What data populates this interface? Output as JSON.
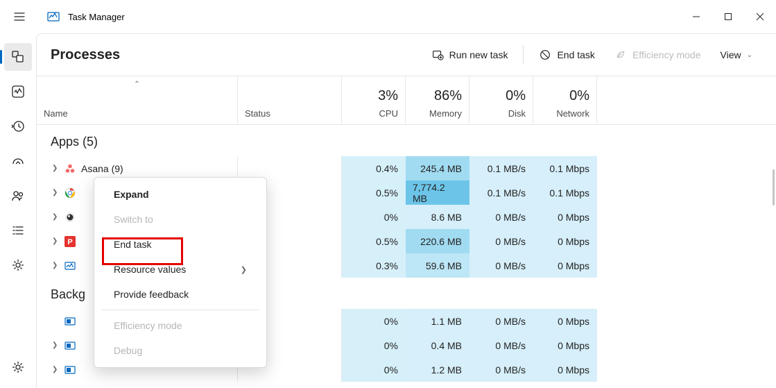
{
  "app": {
    "title": "Task Manager"
  },
  "toolbar": {
    "page_title": "Processes",
    "run_new_task": "Run new task",
    "end_task": "End task",
    "efficiency_mode": "Efficiency mode",
    "view": "View"
  },
  "columns": {
    "name": "Name",
    "status": "Status",
    "cpu": {
      "pct": "3%",
      "label": "CPU"
    },
    "memory": {
      "pct": "86%",
      "label": "Memory"
    },
    "disk": {
      "pct": "0%",
      "label": "Disk"
    },
    "network": {
      "pct": "0%",
      "label": "Network"
    }
  },
  "groups": {
    "apps": {
      "title": "Apps (5)"
    },
    "background": {
      "title": "Backg"
    }
  },
  "rows": [
    {
      "group": "apps",
      "name": "Asana (9)",
      "icon": "asana",
      "cpu": "0.4%",
      "mem": "245.4 MB",
      "disk": "0.1 MB/s",
      "net": "0.1 Mbps",
      "cpu_cls": "badge-fly",
      "mem_cls": "badge-hi",
      "disk_cls": "badge-light",
      "net_cls": "badge-light"
    },
    {
      "group": "apps",
      "name": "",
      "icon": "chrome",
      "cpu": "0.5%",
      "mem": "7,774.2 MB",
      "disk": "0.1 MB/s",
      "net": "0.1 Mbps",
      "cpu_cls": "badge-fly",
      "mem_cls": "badge-hi2",
      "disk_cls": "badge-light",
      "net_cls": "badge-light"
    },
    {
      "group": "apps",
      "name": "",
      "icon": "obs",
      "cpu": "0%",
      "mem": "8.6 MB",
      "disk": "0 MB/s",
      "net": "0 Mbps",
      "cpu_cls": "badge-fly",
      "mem_cls": "badge-light",
      "disk_cls": "badge-light",
      "net_cls": "badge-light"
    },
    {
      "group": "apps",
      "name": "",
      "icon": "p-red",
      "cpu": "0.5%",
      "mem": "220.6 MB",
      "disk": "0 MB/s",
      "net": "0 Mbps",
      "cpu_cls": "badge-fly",
      "mem_cls": "badge-hi",
      "disk_cls": "badge-light",
      "net_cls": "badge-light"
    },
    {
      "group": "apps",
      "name": "",
      "icon": "taskmgr",
      "cpu": "0.3%",
      "mem": "59.6 MB",
      "disk": "0 MB/s",
      "net": "0 Mbps",
      "cpu_cls": "badge-fly",
      "mem_cls": "badge-mid",
      "disk_cls": "badge-light",
      "net_cls": "badge-light"
    },
    {
      "group": "bg",
      "name": "",
      "icon": "generic",
      "cpu": "0%",
      "mem": "1.1 MB",
      "disk": "0 MB/s",
      "net": "0 Mbps",
      "cpu_cls": "badge-fly",
      "mem_cls": "badge-light",
      "disk_cls": "badge-light",
      "net_cls": "badge-light"
    },
    {
      "group": "bg",
      "name": "",
      "icon": "generic",
      "cpu": "0%",
      "mem": "0.4 MB",
      "disk": "0 MB/s",
      "net": "0 Mbps",
      "cpu_cls": "badge-fly",
      "mem_cls": "badge-light",
      "disk_cls": "badge-light",
      "net_cls": "badge-light"
    },
    {
      "group": "bg",
      "name": "",
      "icon": "generic",
      "cpu": "0%",
      "mem": "1.2 MB",
      "disk": "0 MB/s",
      "net": "0 Mbps",
      "cpu_cls": "badge-fly",
      "mem_cls": "badge-light",
      "disk_cls": "badge-light",
      "net_cls": "badge-light"
    }
  ],
  "context_menu": {
    "expand": "Expand",
    "switch_to": "Switch to",
    "end_task": "End task",
    "resource_values": "Resource values",
    "provide_feedback": "Provide feedback",
    "efficiency_mode": "Efficiency mode",
    "debug": "Debug"
  }
}
